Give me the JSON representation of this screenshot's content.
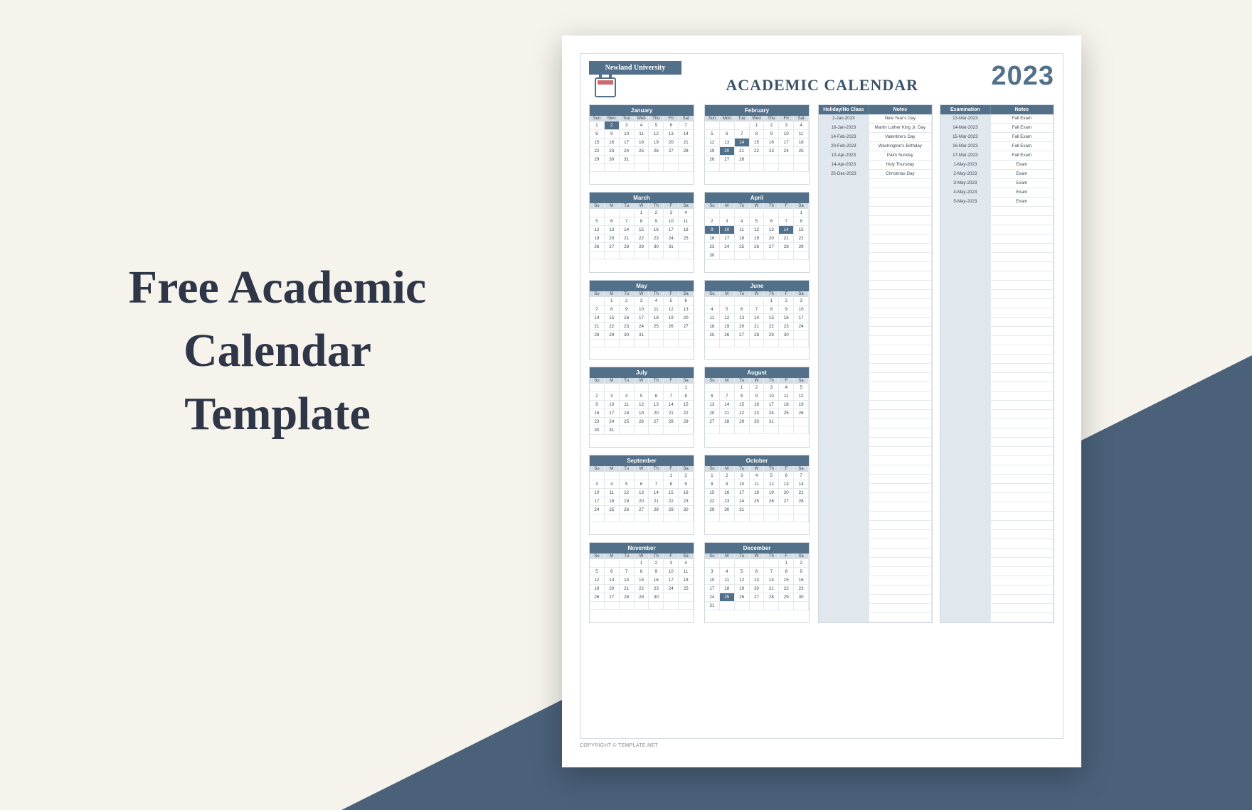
{
  "hero": "Free Academic\nCalendar\nTemplate",
  "university": "Newland University",
  "title": "ACADEMIC CALENDAR",
  "year": "2023",
  "weekdays_long": [
    "Sun",
    "Mon",
    "Tue",
    "Wed",
    "Thu",
    "Fri",
    "Sat"
  ],
  "weekdays_short": [
    "Su",
    "M",
    "Tu",
    "W",
    "Th",
    "F",
    "Sa"
  ],
  "months": [
    {
      "name": "January",
      "long_wd": true,
      "start": 0,
      "days": 31,
      "hl": [
        2
      ]
    },
    {
      "name": "February",
      "long_wd": true,
      "start": 3,
      "days": 28,
      "hl": [
        14,
        20
      ]
    },
    {
      "name": "March",
      "long_wd": false,
      "start": 3,
      "days": 31,
      "hl": []
    },
    {
      "name": "April",
      "long_wd": false,
      "start": 6,
      "days": 30,
      "hl": [
        9,
        10,
        14
      ]
    },
    {
      "name": "May",
      "long_wd": false,
      "start": 1,
      "days": 31,
      "hl": []
    },
    {
      "name": "June",
      "long_wd": false,
      "start": 4,
      "days": 30,
      "hl": []
    },
    {
      "name": "July",
      "long_wd": false,
      "start": 6,
      "days": 31,
      "hl": []
    },
    {
      "name": "August",
      "long_wd": false,
      "start": 2,
      "days": 31,
      "hl": []
    },
    {
      "name": "September",
      "long_wd": false,
      "start": 5,
      "days": 30,
      "hl": []
    },
    {
      "name": "October",
      "long_wd": false,
      "start": 0,
      "days": 31,
      "hl": []
    },
    {
      "name": "November",
      "long_wd": false,
      "start": 3,
      "days": 30,
      "hl": []
    },
    {
      "name": "December",
      "long_wd": false,
      "start": 5,
      "days": 31,
      "hl": [
        25
      ]
    }
  ],
  "tables": [
    {
      "headers": [
        "Holiday/No Class",
        "Notes"
      ],
      "rows": [
        [
          "2-Jan-2023",
          "New Year's Day"
        ],
        [
          "16-Jan-2023",
          "Martin Luther King Jr. Day"
        ],
        [
          "14-Feb-2023",
          "Valentine's Day"
        ],
        [
          "20-Feb-2023",
          "Washington's Birthday"
        ],
        [
          "10-Apr-2023",
          "Palm Sunday"
        ],
        [
          "14-Apr-2023",
          "Holy Thursday"
        ],
        [
          "25-Dec-2023",
          "Christmas Day"
        ]
      ],
      "blank_rows": 48
    },
    {
      "headers": [
        "Examination",
        "Notes"
      ],
      "rows": [
        [
          "13-Mar-2023",
          "Fall Exam"
        ],
        [
          "14-Mar-2023",
          "Fall Exam"
        ],
        [
          "15-Mar-2023",
          "Fall Exam"
        ],
        [
          "16-Mar-2023",
          "Fall Exam"
        ],
        [
          "17-Mar-2023",
          "Fall Exam"
        ],
        [
          "1-May-2023",
          "Exam"
        ],
        [
          "2-May-2023",
          "Exam"
        ],
        [
          "3-May-2023",
          "Exam"
        ],
        [
          "4-May-2023",
          "Exam"
        ],
        [
          "5-May-2023",
          "Exam"
        ]
      ],
      "blank_rows": 45
    }
  ],
  "copyright": "COPYRIGHT © TEMPLATE.NET"
}
